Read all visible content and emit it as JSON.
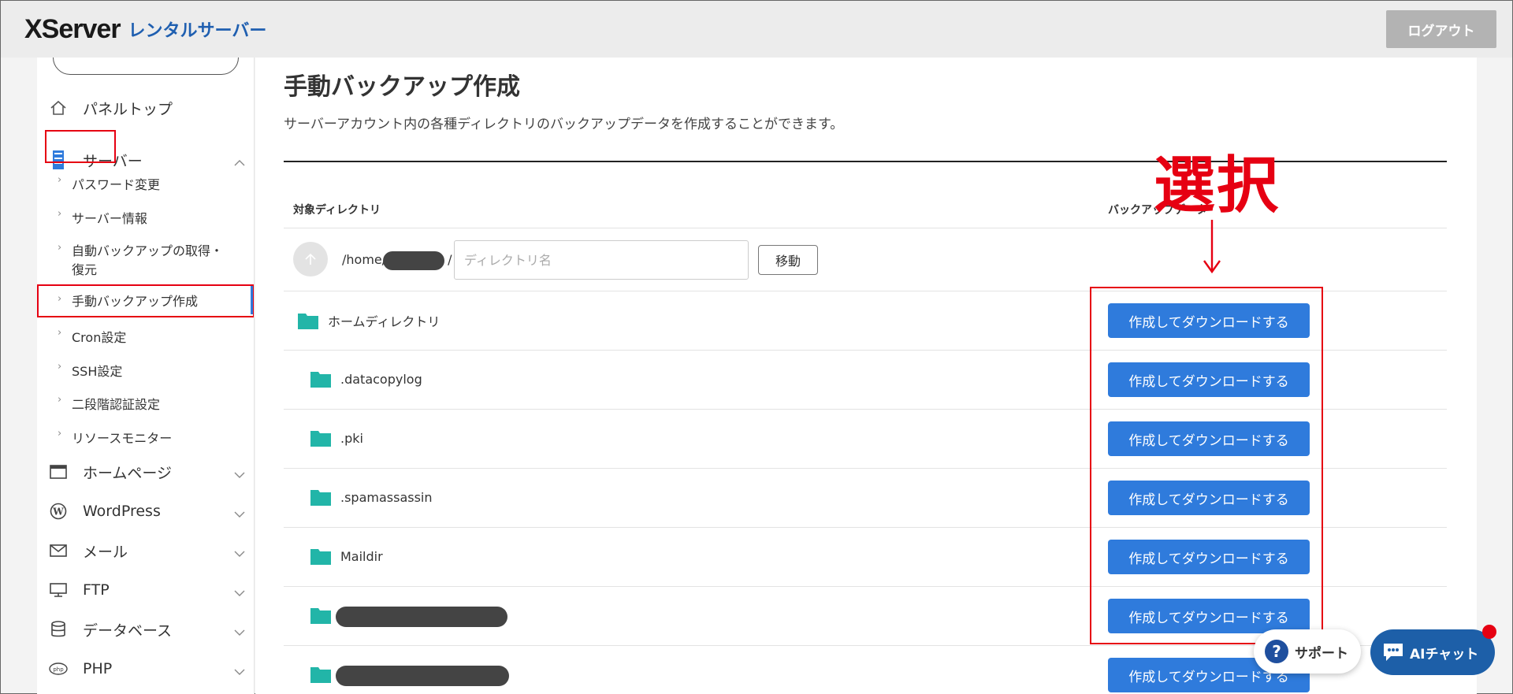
{
  "header": {
    "logo_main": "XServer",
    "logo_sub": "レンタルサーバー",
    "logout_label": "ログアウト"
  },
  "sidebar": {
    "panel_top": "パネルトップ",
    "server": "サーバー",
    "server_sub": [
      "パスワード変更",
      "サーバー情報",
      "自動バックアップの取得・",
      "復元",
      "手動バックアップ作成",
      "Cron設定",
      "SSH設定",
      "二段階認証設定",
      "リソースモニター"
    ],
    "sections": [
      "ホームページ",
      "WordPress",
      "メール",
      "FTP",
      "データベース",
      "PHP"
    ]
  },
  "main": {
    "title": "手動バックアップ作成",
    "description": "サーバーアカウント内の各種ディレクトリのバックアップデータを作成することができます。",
    "col_directory": "対象ディレクトリ",
    "col_backup": "バックアップデータ",
    "path_prefix": "/home/",
    "path_suffix": "/",
    "dir_placeholder": "ディレクトリ名",
    "move_label": "移動",
    "rows": [
      {
        "name": "ホームディレクトリ",
        "action": "作成してダウンロードする"
      },
      {
        "name": ".datacopylog",
        "action": "作成してダウンロードする"
      },
      {
        "name": ".pki",
        "action": "作成してダウンロードする"
      },
      {
        "name": ".spamassassin",
        "action": "作成してダウンロードする"
      },
      {
        "name": "Maildir",
        "action": "作成してダウンロードする"
      },
      {
        "name": "",
        "action": "作成してダウンロードする"
      },
      {
        "name": "",
        "action": "作成してダウンロードする"
      }
    ]
  },
  "annotation": {
    "text": "選択",
    "color": "#e60012"
  },
  "floating": {
    "support_label": "サポート",
    "support_icon": "?",
    "ai_label": "AIチャット"
  },
  "colors": {
    "accent": "#2f7bdc",
    "folder": "#22b5a8",
    "annotation": "#e60012"
  }
}
